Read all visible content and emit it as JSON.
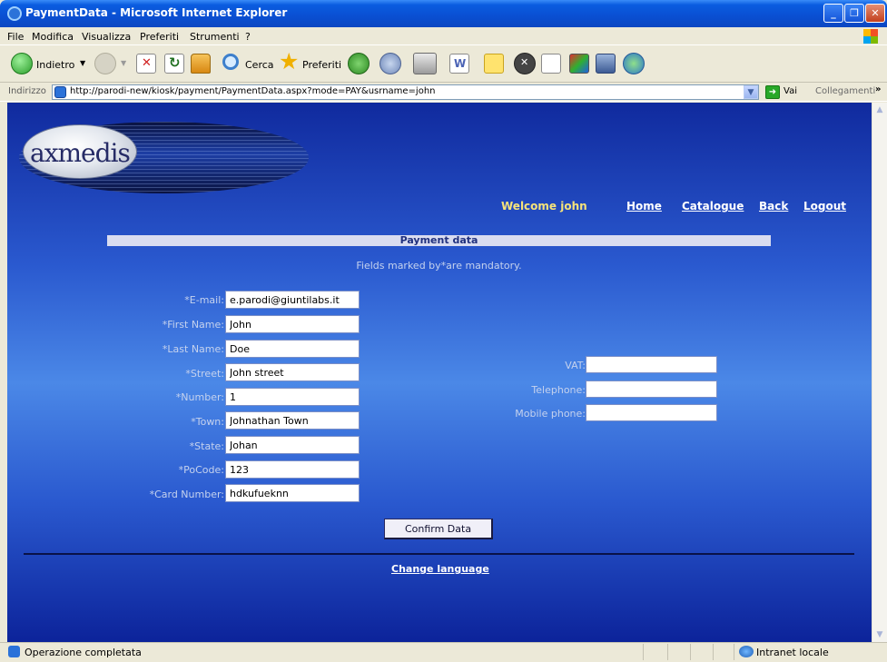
{
  "window": {
    "title": "PaymentData - Microsoft Internet Explorer"
  },
  "menu": [
    "File",
    "Modifica",
    "Visualizza",
    "Preferiti",
    "Strumenti",
    "?"
  ],
  "toolbar": {
    "back": "Indietro",
    "search": "Cerca",
    "favorites": "Preferiti"
  },
  "address": {
    "label": "Indirizzo",
    "url": "http://parodi-new/kiosk/payment/PaymentData.aspx?mode=PAY&usrname=john",
    "go": "Vai",
    "links": "Collegamenti"
  },
  "page": {
    "logo": "axmedis",
    "welcome": "Welcome john",
    "nav": [
      "Home",
      "Catalogue",
      "Back",
      "Logout"
    ],
    "section_title": "Payment data",
    "mandatory_note": "Fields marked by*are mandatory.",
    "form": [
      {
        "label": "*E-mail:",
        "value": "e.parodi@giuntilabs.it"
      },
      {
        "label": "*First Name:",
        "value": "John"
      },
      {
        "label": "*Last Name:",
        "value": "Doe"
      },
      {
        "label": "*Street:",
        "value": "John street"
      },
      {
        "label": "*Number:",
        "value": "1"
      },
      {
        "label": "*Town:",
        "value": "Johnathan Town"
      },
      {
        "label": "*State:",
        "value": "Johan"
      },
      {
        "label": "*PoCode:",
        "value": "123"
      },
      {
        "label": "*Card Number:",
        "value": "hdkufueknn"
      }
    ],
    "optional": [
      {
        "label": "VAT:",
        "value": ""
      },
      {
        "label": "Telephone:",
        "value": ""
      },
      {
        "label": "Mobile phone:",
        "value": ""
      }
    ],
    "confirm": "Confirm Data",
    "change_language": "Change language"
  },
  "status": {
    "text": "Operazione completata",
    "zone": "Intranet locale"
  }
}
